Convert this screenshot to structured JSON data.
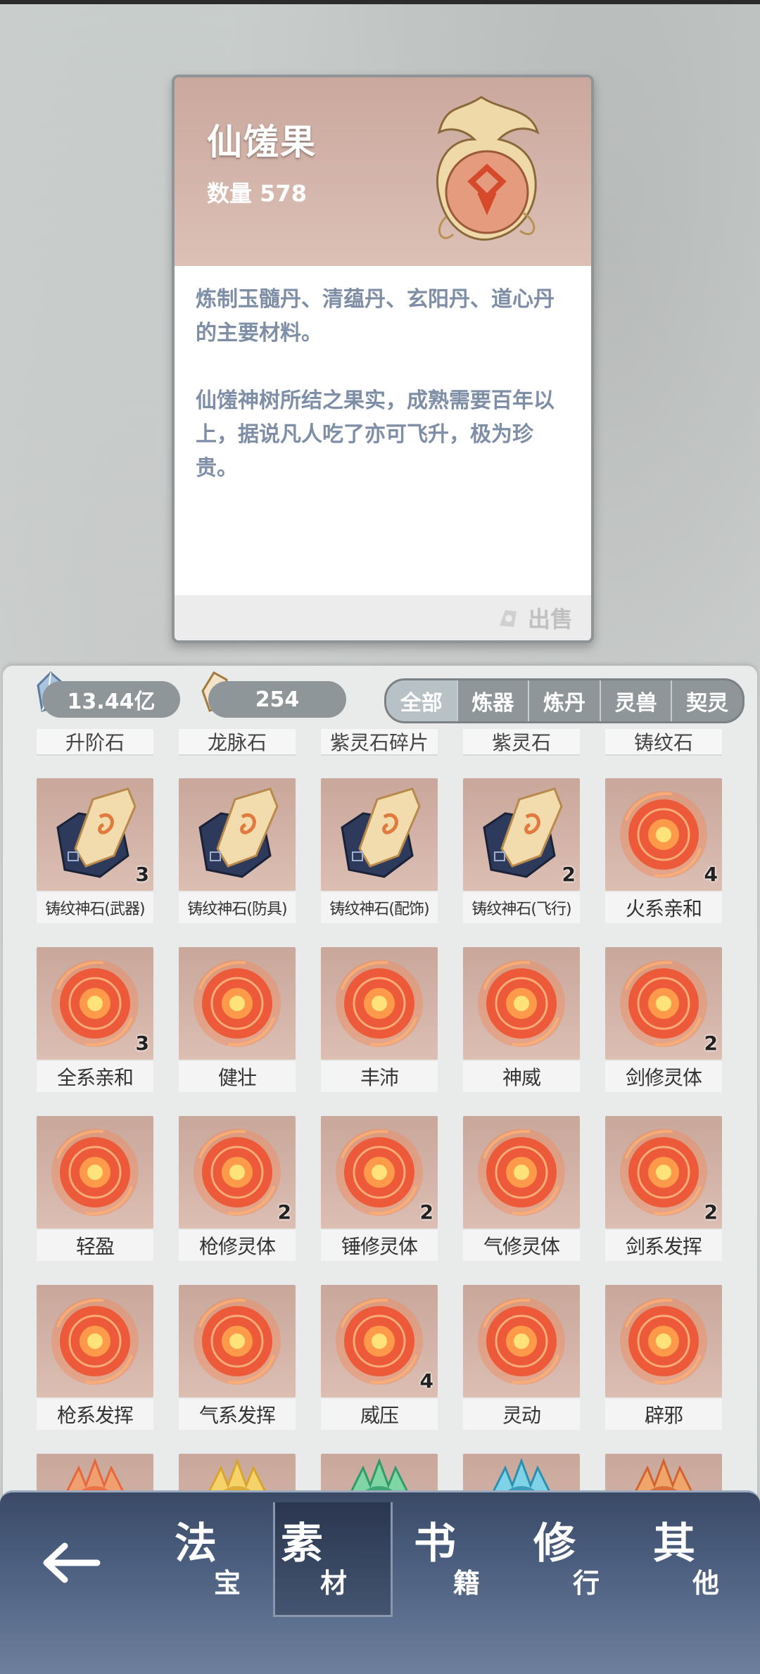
{
  "detail": {
    "title": "仙馐果",
    "quantity_label": "数量",
    "quantity_value": "578",
    "description_1": "炼制玉髓丹、清蕴丹、玄阳丹、道心丹的主要材料。",
    "description_2": "仙馐神树所结之果实，成熟需要百年以上，据说凡人吃了亦可飞升，极为珍贵。",
    "sell_label": "出售"
  },
  "currency": {
    "spirit_stone": "13.44亿",
    "fate_stone": "254"
  },
  "filters": [
    "全部",
    "炼器",
    "炼丹",
    "灵兽",
    "契灵"
  ],
  "partial_row_labels": [
    "升阶石",
    "龙脉石",
    "紫灵石碎片",
    "紫灵石",
    "铸纹石"
  ],
  "items": [
    {
      "label": "铸纹神石(武器)",
      "count": "3",
      "art": "forge-stone"
    },
    {
      "label": "铸纹神石(防具)",
      "count": "",
      "art": "forge-stone"
    },
    {
      "label": "铸纹神石(配饰)",
      "count": "",
      "art": "forge-stone"
    },
    {
      "label": "铸纹神石(飞行)",
      "count": "2",
      "art": "forge-stone"
    },
    {
      "label": "火系亲和",
      "count": "4",
      "art": "fire-orb"
    },
    {
      "label": "全系亲和",
      "count": "3",
      "art": "fire-orb"
    },
    {
      "label": "健壮",
      "count": "",
      "art": "fire-orb"
    },
    {
      "label": "丰沛",
      "count": "",
      "art": "fire-orb"
    },
    {
      "label": "神威",
      "count": "",
      "art": "fire-orb"
    },
    {
      "label": "剑修灵体",
      "count": "2",
      "art": "fire-orb"
    },
    {
      "label": "轻盈",
      "count": "",
      "art": "fire-orb"
    },
    {
      "label": "枪修灵体",
      "count": "2",
      "art": "fire-orb"
    },
    {
      "label": "锤修灵体",
      "count": "2",
      "art": "fire-orb"
    },
    {
      "label": "气修灵体",
      "count": "",
      "art": "fire-orb"
    },
    {
      "label": "剑系发挥",
      "count": "2",
      "art": "fire-orb"
    },
    {
      "label": "枪系发挥",
      "count": "",
      "art": "fire-orb"
    },
    {
      "label": "气系发挥",
      "count": "",
      "art": "fire-orb"
    },
    {
      "label": "威压",
      "count": "4",
      "art": "fire-orb"
    },
    {
      "label": "灵动",
      "count": "",
      "art": "fire-orb"
    },
    {
      "label": "辟邪",
      "count": "",
      "art": "fire-orb"
    }
  ],
  "partial_row_art": [
    "flame-crest",
    "gold-crest",
    "green-crest",
    "cyan-crest",
    "orange-crest"
  ],
  "nav": {
    "back_icon": "arrow-left-icon",
    "tabs": [
      {
        "big": "法",
        "small": "宝"
      },
      {
        "big": "素",
        "small": "材"
      },
      {
        "big": "书",
        "small": "籍"
      },
      {
        "big": "修",
        "small": "行"
      },
      {
        "big": "其",
        "small": "他"
      }
    ],
    "active_tab": 1
  }
}
